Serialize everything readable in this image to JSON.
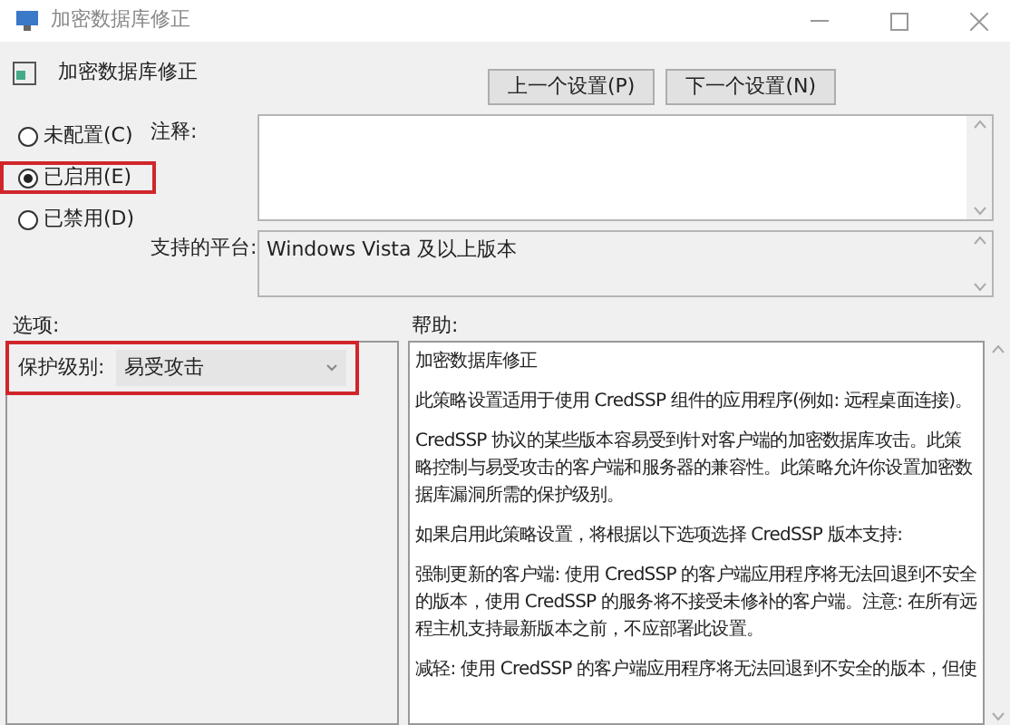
{
  "window": {
    "title": "加密数据库修正"
  },
  "header": {
    "title": "加密数据库修正",
    "buttons": [
      {
        "label": "上一个设置(P)"
      },
      {
        "label": "下一个设置(N)"
      }
    ]
  },
  "radios": [
    {
      "label": "未配置(C)",
      "selected": false,
      "highlighted": false
    },
    {
      "label": "已启用(E)",
      "selected": true,
      "highlighted": true
    },
    {
      "label": "已禁用(D)",
      "selected": false,
      "highlighted": false
    }
  ],
  "comment": {
    "label": "注释:"
  },
  "platform": {
    "label": "支持的平台:",
    "value": "Windows Vista 及以上版本"
  },
  "options": {
    "label": "选项:",
    "field_label": "保护级别:",
    "value": "易受攻击",
    "highlighted": true
  },
  "help": {
    "label": "帮助:",
    "paragraphs": [
      "加密数据库修正",
      "此策略设置适用于使用 CredSSP 组件的应用程序(例如: 远程桌面连接)。",
      "CredSSP 协议的某些版本容易受到针对客户端的加密数据库攻击。此策略控制与易受攻击的客户端和服务器的兼容性。此策略允许你设置加密数据库漏洞所需的保护级别。",
      "如果启用此策略设置，将根据以下选项选择 CredSSP 版本支持:",
      "强制更新的客户端: 使用 CredSSP 的客户端应用程序将无法回退到不安全的版本，使用 CredSSP 的服务将不接受未修补的客户端。注意: 在所有远程主机支持最新版本之前，不应部署此设置。",
      "减轻: 使用 CredSSP 的客户端应用程序将无法回退到不安全的版本，但使"
    ]
  }
}
